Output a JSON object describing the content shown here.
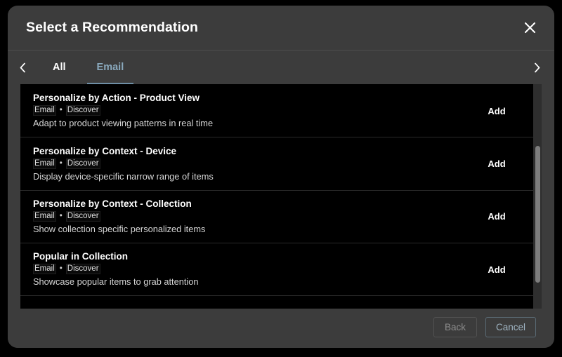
{
  "dialog": {
    "title": "Select a Recommendation",
    "close_icon": "close-icon"
  },
  "tabbar": {
    "prev_icon": "chevron-left-icon",
    "next_icon": "chevron-right-icon",
    "tabs": [
      {
        "label": "All",
        "selected": false
      },
      {
        "label": "Email",
        "selected": true
      }
    ]
  },
  "list": {
    "add_label": "Add",
    "tag_separator": "•",
    "items": [
      {
        "title": "Personalize by Action - Product View",
        "tag1": "Email",
        "tag2": "Discover",
        "description": "Adapt to product viewing patterns in real time",
        "action": "Add"
      },
      {
        "title": "Personalize by Context - Device",
        "tag1": "Email",
        "tag2": "Discover",
        "description": "Display device-specific narrow range of items",
        "action": "Add"
      },
      {
        "title": "Personalize by Context - Collection",
        "tag1": "Email",
        "tag2": "Discover",
        "description": "Show collection specific personalized items",
        "action": "Add"
      },
      {
        "title": "Popular in Collection",
        "tag1": "Email",
        "tag2": "Discover",
        "description": "Showcase popular items to grab attention",
        "action": "Add"
      }
    ]
  },
  "footer": {
    "back_label": "Back",
    "cancel_label": "Cancel"
  },
  "colors": {
    "modal_bg": "#3c3c3c",
    "list_bg": "#000000",
    "accent": "#8aa9bd",
    "cancel_border": "#5a6a74",
    "scrollbar_thumb": "#7d7d7d"
  }
}
